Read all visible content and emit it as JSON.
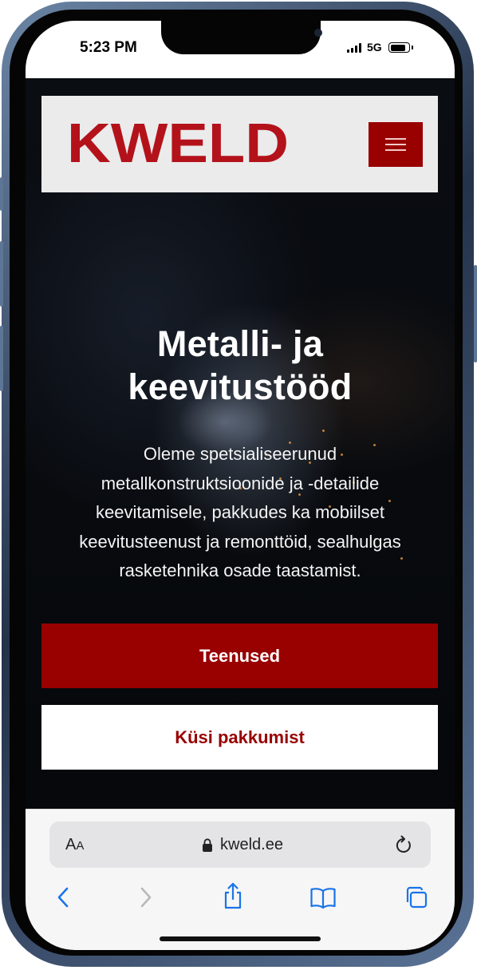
{
  "status_bar": {
    "time": "5:23 PM",
    "network": "5G"
  },
  "header": {
    "logo_text": "KWELD",
    "menu_label": "Menu"
  },
  "hero": {
    "title_line1": "Metalli- ja",
    "title_line2": "keevitustööd",
    "description_lines": [
      "Oleme spetsialiseerunud",
      "metallkonstruktsioonide ja -detailide",
      "keevitamisele, pakkudes ka mobiilset",
      "keevitusteenust ja remonttöid, sealhulgas",
      "rasketehnika osade taastamist."
    ]
  },
  "buttons": {
    "primary": "Teenused",
    "secondary": "Küsi pakkumist"
  },
  "browser": {
    "aa_large": "A",
    "aa_small": "A",
    "url": "kweld.ee"
  },
  "colors": {
    "brand_red": "#990000",
    "logo_red": "#b4121b",
    "header_bg": "#ebebeb",
    "safari_blue": "#1a73e8"
  },
  "icons": {
    "menu": "hamburger-icon",
    "lock": "lock-icon",
    "reload": "reload-icon",
    "back": "chevron-left-icon",
    "forward": "chevron-right-icon",
    "share": "share-icon",
    "bookmarks": "book-icon",
    "tabs": "tabs-icon"
  }
}
